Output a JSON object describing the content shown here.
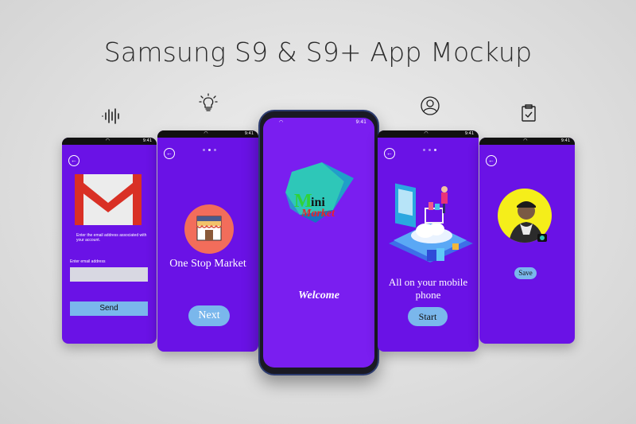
{
  "title": "Samsung S9 & S9+ App Mockup",
  "colors": {
    "screen": "#6a12e6",
    "button": "#7ab7ec",
    "yellow": "#f5ee1a",
    "gmail_red": "#d93025"
  },
  "icons": [
    "sound-wave-icon",
    "lightbulb-icon",
    "user-icon",
    "clipboard-check-icon"
  ],
  "status_time": "9:41",
  "screen1": {
    "instruction": "Enter the email address associated with your account.",
    "field_label": "Enter email address",
    "button": "Send"
  },
  "screen2": {
    "heading": "One Stop Market",
    "button": "Next"
  },
  "center": {
    "logo_m": "M",
    "logo_ini": "ini",
    "logo_market": "Market",
    "welcome": "Welcome"
  },
  "screen4": {
    "heading": "All on your mobile phone",
    "button": "Start"
  },
  "screen5": {
    "button": "Save"
  }
}
